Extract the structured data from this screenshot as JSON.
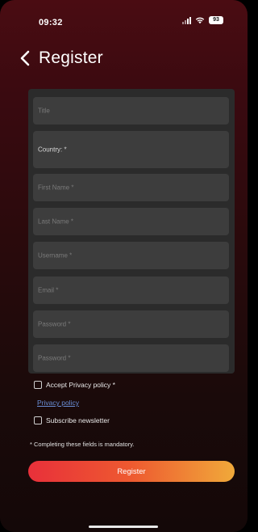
{
  "status_bar": {
    "time": "09:32",
    "battery": "93"
  },
  "nav": {
    "title": "Register"
  },
  "form": {
    "title_placeholder": "Title",
    "country_label": "Country: *",
    "first_name_placeholder": "First Name *",
    "last_name_placeholder": "Last Name *",
    "username_placeholder": "Username *",
    "email_placeholder": "Email *",
    "password_placeholder": "Password *",
    "password_confirm_placeholder": "Password *",
    "accept_privacy_label": "Accept Privacy policy *",
    "accept_privacy_checked": false,
    "privacy_link": "Privacy policy",
    "subscribe_label": "Subscribe newsletter",
    "subscribe_checked": false
  },
  "footer": {
    "mandatory_note": "* Completing these fields is mandatory.",
    "register_button": "Register"
  },
  "colors": {
    "background_top": "#4a0c12",
    "background_bottom": "#140808",
    "card": "#2b2b2b",
    "field": "#3d3d3d",
    "link": "#6a8fd8",
    "button_start": "#e8303a",
    "button_end": "#f0a93a"
  },
  "icons": {
    "back": "chevron-left-icon",
    "signal": "signal-icon",
    "wifi": "wifi-icon",
    "battery": "battery-icon"
  }
}
